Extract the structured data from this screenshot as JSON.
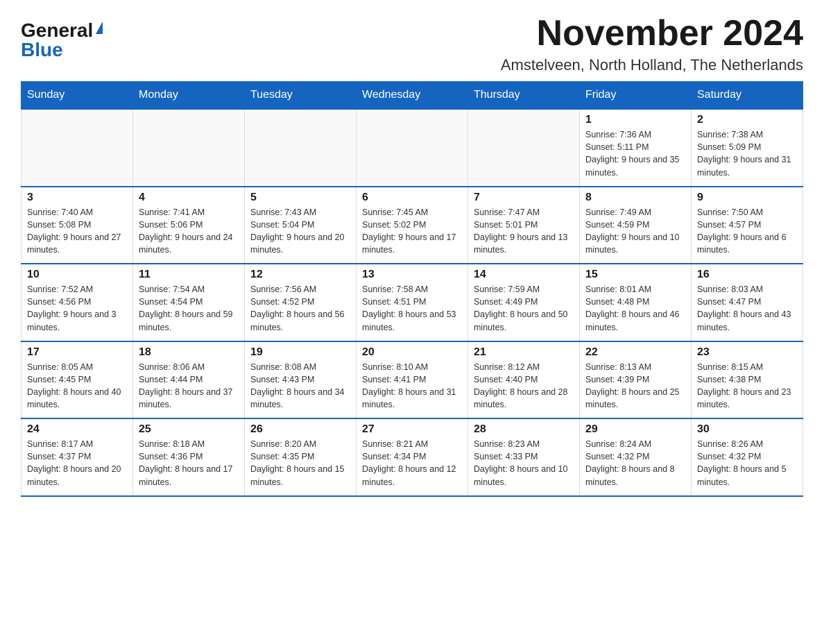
{
  "header": {
    "logo_general": "General",
    "logo_blue": "Blue",
    "month_title": "November 2024",
    "subtitle": "Amstelveen, North Holland, The Netherlands"
  },
  "weekdays": [
    "Sunday",
    "Monday",
    "Tuesday",
    "Wednesday",
    "Thursday",
    "Friday",
    "Saturday"
  ],
  "weeks": [
    [
      {
        "day": "",
        "info": ""
      },
      {
        "day": "",
        "info": ""
      },
      {
        "day": "",
        "info": ""
      },
      {
        "day": "",
        "info": ""
      },
      {
        "day": "",
        "info": ""
      },
      {
        "day": "1",
        "info": "Sunrise: 7:36 AM\nSunset: 5:11 PM\nDaylight: 9 hours and 35 minutes."
      },
      {
        "day": "2",
        "info": "Sunrise: 7:38 AM\nSunset: 5:09 PM\nDaylight: 9 hours and 31 minutes."
      }
    ],
    [
      {
        "day": "3",
        "info": "Sunrise: 7:40 AM\nSunset: 5:08 PM\nDaylight: 9 hours and 27 minutes."
      },
      {
        "day": "4",
        "info": "Sunrise: 7:41 AM\nSunset: 5:06 PM\nDaylight: 9 hours and 24 minutes."
      },
      {
        "day": "5",
        "info": "Sunrise: 7:43 AM\nSunset: 5:04 PM\nDaylight: 9 hours and 20 minutes."
      },
      {
        "day": "6",
        "info": "Sunrise: 7:45 AM\nSunset: 5:02 PM\nDaylight: 9 hours and 17 minutes."
      },
      {
        "day": "7",
        "info": "Sunrise: 7:47 AM\nSunset: 5:01 PM\nDaylight: 9 hours and 13 minutes."
      },
      {
        "day": "8",
        "info": "Sunrise: 7:49 AM\nSunset: 4:59 PM\nDaylight: 9 hours and 10 minutes."
      },
      {
        "day": "9",
        "info": "Sunrise: 7:50 AM\nSunset: 4:57 PM\nDaylight: 9 hours and 6 minutes."
      }
    ],
    [
      {
        "day": "10",
        "info": "Sunrise: 7:52 AM\nSunset: 4:56 PM\nDaylight: 9 hours and 3 minutes."
      },
      {
        "day": "11",
        "info": "Sunrise: 7:54 AM\nSunset: 4:54 PM\nDaylight: 8 hours and 59 minutes."
      },
      {
        "day": "12",
        "info": "Sunrise: 7:56 AM\nSunset: 4:52 PM\nDaylight: 8 hours and 56 minutes."
      },
      {
        "day": "13",
        "info": "Sunrise: 7:58 AM\nSunset: 4:51 PM\nDaylight: 8 hours and 53 minutes."
      },
      {
        "day": "14",
        "info": "Sunrise: 7:59 AM\nSunset: 4:49 PM\nDaylight: 8 hours and 50 minutes."
      },
      {
        "day": "15",
        "info": "Sunrise: 8:01 AM\nSunset: 4:48 PM\nDaylight: 8 hours and 46 minutes."
      },
      {
        "day": "16",
        "info": "Sunrise: 8:03 AM\nSunset: 4:47 PM\nDaylight: 8 hours and 43 minutes."
      }
    ],
    [
      {
        "day": "17",
        "info": "Sunrise: 8:05 AM\nSunset: 4:45 PM\nDaylight: 8 hours and 40 minutes."
      },
      {
        "day": "18",
        "info": "Sunrise: 8:06 AM\nSunset: 4:44 PM\nDaylight: 8 hours and 37 minutes."
      },
      {
        "day": "19",
        "info": "Sunrise: 8:08 AM\nSunset: 4:43 PM\nDaylight: 8 hours and 34 minutes."
      },
      {
        "day": "20",
        "info": "Sunrise: 8:10 AM\nSunset: 4:41 PM\nDaylight: 8 hours and 31 minutes."
      },
      {
        "day": "21",
        "info": "Sunrise: 8:12 AM\nSunset: 4:40 PM\nDaylight: 8 hours and 28 minutes."
      },
      {
        "day": "22",
        "info": "Sunrise: 8:13 AM\nSunset: 4:39 PM\nDaylight: 8 hours and 25 minutes."
      },
      {
        "day": "23",
        "info": "Sunrise: 8:15 AM\nSunset: 4:38 PM\nDaylight: 8 hours and 23 minutes."
      }
    ],
    [
      {
        "day": "24",
        "info": "Sunrise: 8:17 AM\nSunset: 4:37 PM\nDaylight: 8 hours and 20 minutes."
      },
      {
        "day": "25",
        "info": "Sunrise: 8:18 AM\nSunset: 4:36 PM\nDaylight: 8 hours and 17 minutes."
      },
      {
        "day": "26",
        "info": "Sunrise: 8:20 AM\nSunset: 4:35 PM\nDaylight: 8 hours and 15 minutes."
      },
      {
        "day": "27",
        "info": "Sunrise: 8:21 AM\nSunset: 4:34 PM\nDaylight: 8 hours and 12 minutes."
      },
      {
        "day": "28",
        "info": "Sunrise: 8:23 AM\nSunset: 4:33 PM\nDaylight: 8 hours and 10 minutes."
      },
      {
        "day": "29",
        "info": "Sunrise: 8:24 AM\nSunset: 4:32 PM\nDaylight: 8 hours and 8 minutes."
      },
      {
        "day": "30",
        "info": "Sunrise: 8:26 AM\nSunset: 4:32 PM\nDaylight: 8 hours and 5 minutes."
      }
    ]
  ]
}
